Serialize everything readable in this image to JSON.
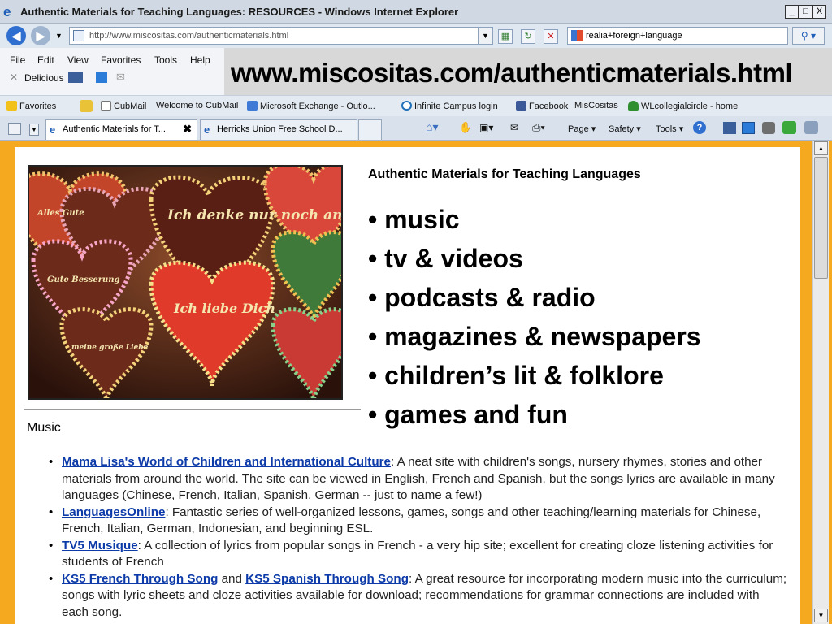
{
  "window": {
    "title": "Authentic Materials for Teaching Languages: RESOURCES - Windows Internet Explorer",
    "min": "_",
    "max": "□",
    "close": "X"
  },
  "address": {
    "url": "http://www.miscositas.com/authenticmaterials.html",
    "search_query": "realia+foreign+language"
  },
  "menu": {
    "items": [
      "File",
      "Edit",
      "View",
      "Favorites",
      "Tools",
      "Help"
    ],
    "delicious": "Delicious"
  },
  "banner_url": "www.miscositas.com/authenticmaterials.html",
  "favorites": {
    "label": "Favorites",
    "items": [
      "CubMail",
      "Welcome to CubMail",
      "Microsoft Exchange - Outlo...",
      "Infinite Campus login",
      "Facebook",
      "MisCositas",
      "WLcollegialcircle - home"
    ]
  },
  "tabs": [
    {
      "label": "Authentic Materials for T...",
      "close": "✖"
    },
    {
      "label": "Herricks Union Free School D..."
    }
  ],
  "commandbar": {
    "page": "Page",
    "safety": "Safety",
    "tools": "Tools"
  },
  "content": {
    "heading": "Authentic Materials for Teaching Languages",
    "bullets": [
      "• music",
      "• tv & videos",
      "• podcasts & radio",
      "• magazines & newspapers",
      "• children’s lit & folklore",
      "• games and fun"
    ],
    "section_title": "Music",
    "photo_texts": [
      "Ich denke nur noch an Dich",
      "Ich liebe Dich",
      "Alles Gute",
      "Gute Besserung",
      "meine große Liebe"
    ],
    "music_items": [
      {
        "link": "Mama Lisa's World of Children and International Culture",
        "text": ": A neat site with children's songs, nursery rhymes, stories and other materials from around the world. The site can be viewed in English, French and Spanish, but the songs lyrics are available in many languages (Chinese, French, Italian, Spanish, German -- just to name a few!)"
      },
      {
        "link": "LanguagesOnline",
        "text": ": Fantastic series of well-organized lessons, games, songs and other teaching/learning materials for Chinese, French, Italian, German, Indonesian, and beginning ESL."
      },
      {
        "link": "TV5 Musique",
        "text": ": A collection of lyrics from popular songs in French - a very hip site; excellent for creating cloze listening activities for students of French"
      },
      {
        "link": "KS5 French Through Song",
        "mid": " and ",
        "link2": "KS5 Spanish Through Song",
        "text": ": A great resource for incorporating modern music into the curriculum; songs with lyric sheets and cloze activities available for download; recommendations for grammar connections are included with each song."
      }
    ]
  }
}
